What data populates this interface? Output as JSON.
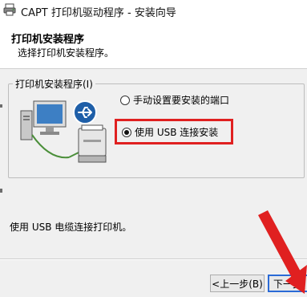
{
  "window": {
    "title": "CAPT 打印机驱动程序 - 安装向导"
  },
  "header": {
    "heading": "打印机安装程序",
    "subheading": "选择打印机安装程序。"
  },
  "group": {
    "label": "打印机安装程序(I)",
    "options": [
      {
        "label": "手动设置要安装的端口",
        "checked": false
      },
      {
        "label": "使用 USB 连接安装",
        "checked": true
      }
    ]
  },
  "status": {
    "text": "使用 USB 电缆连接打印机。"
  },
  "buttons": {
    "back_label": "<上一步(B)",
    "next_label": "下一步("
  },
  "colors": {
    "highlight": "#e02020",
    "arrow": "#e02020",
    "default_button_border": "#2a6ad6"
  },
  "icons": {
    "app": "printer-icon",
    "illustration": "computer-usb-printer-icon"
  }
}
